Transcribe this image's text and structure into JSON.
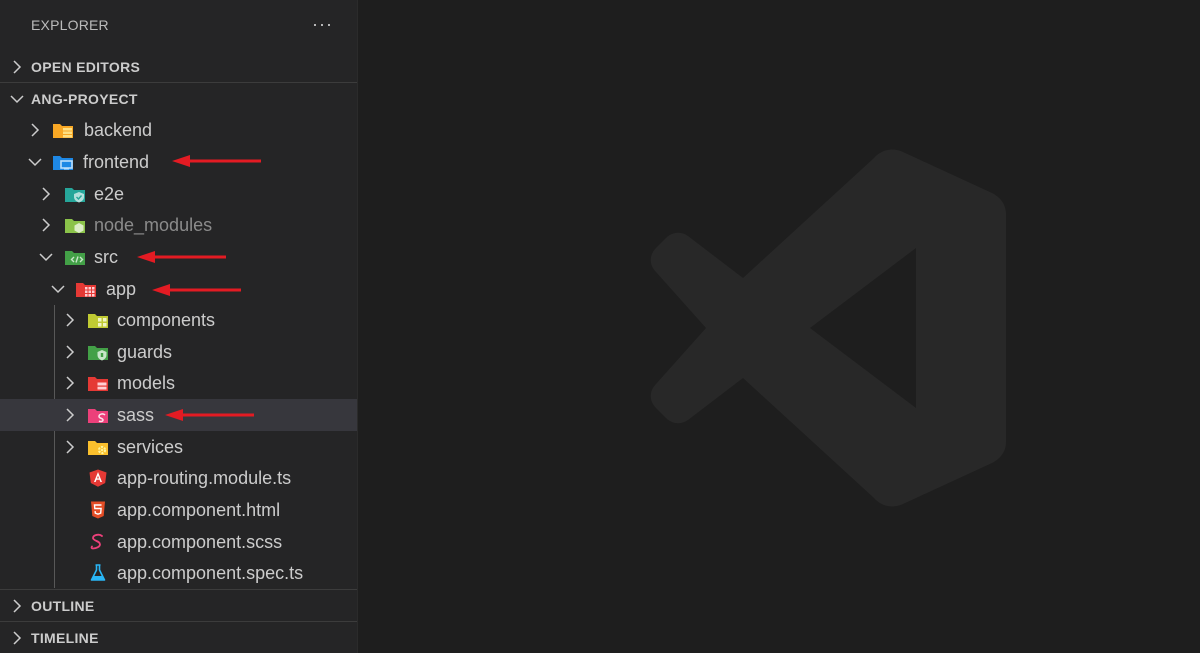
{
  "explorer": {
    "title": "EXPLORER",
    "more_label": "···"
  },
  "sections": {
    "open_editors": "OPEN EDITORS",
    "project": "ANG-PROYECT",
    "outline": "OUTLINE",
    "timeline": "TIMELINE"
  },
  "tree": {
    "backend": "backend",
    "frontend": "frontend",
    "e2e": "e2e",
    "node_modules": "node_modules",
    "src": "src",
    "app": "app",
    "components": "components",
    "guards": "guards",
    "models": "models",
    "sass": "sass",
    "services": "services",
    "routing": "app-routing.module.ts",
    "html": "app.component.html",
    "scss": "app.component.scss",
    "spec": "app.component.spec.ts"
  },
  "colors": {
    "annotation_arrow": "#e31b23",
    "sidebar_bg": "#252526",
    "editor_bg": "#1e1e1e",
    "selection_bg": "#37373d"
  }
}
